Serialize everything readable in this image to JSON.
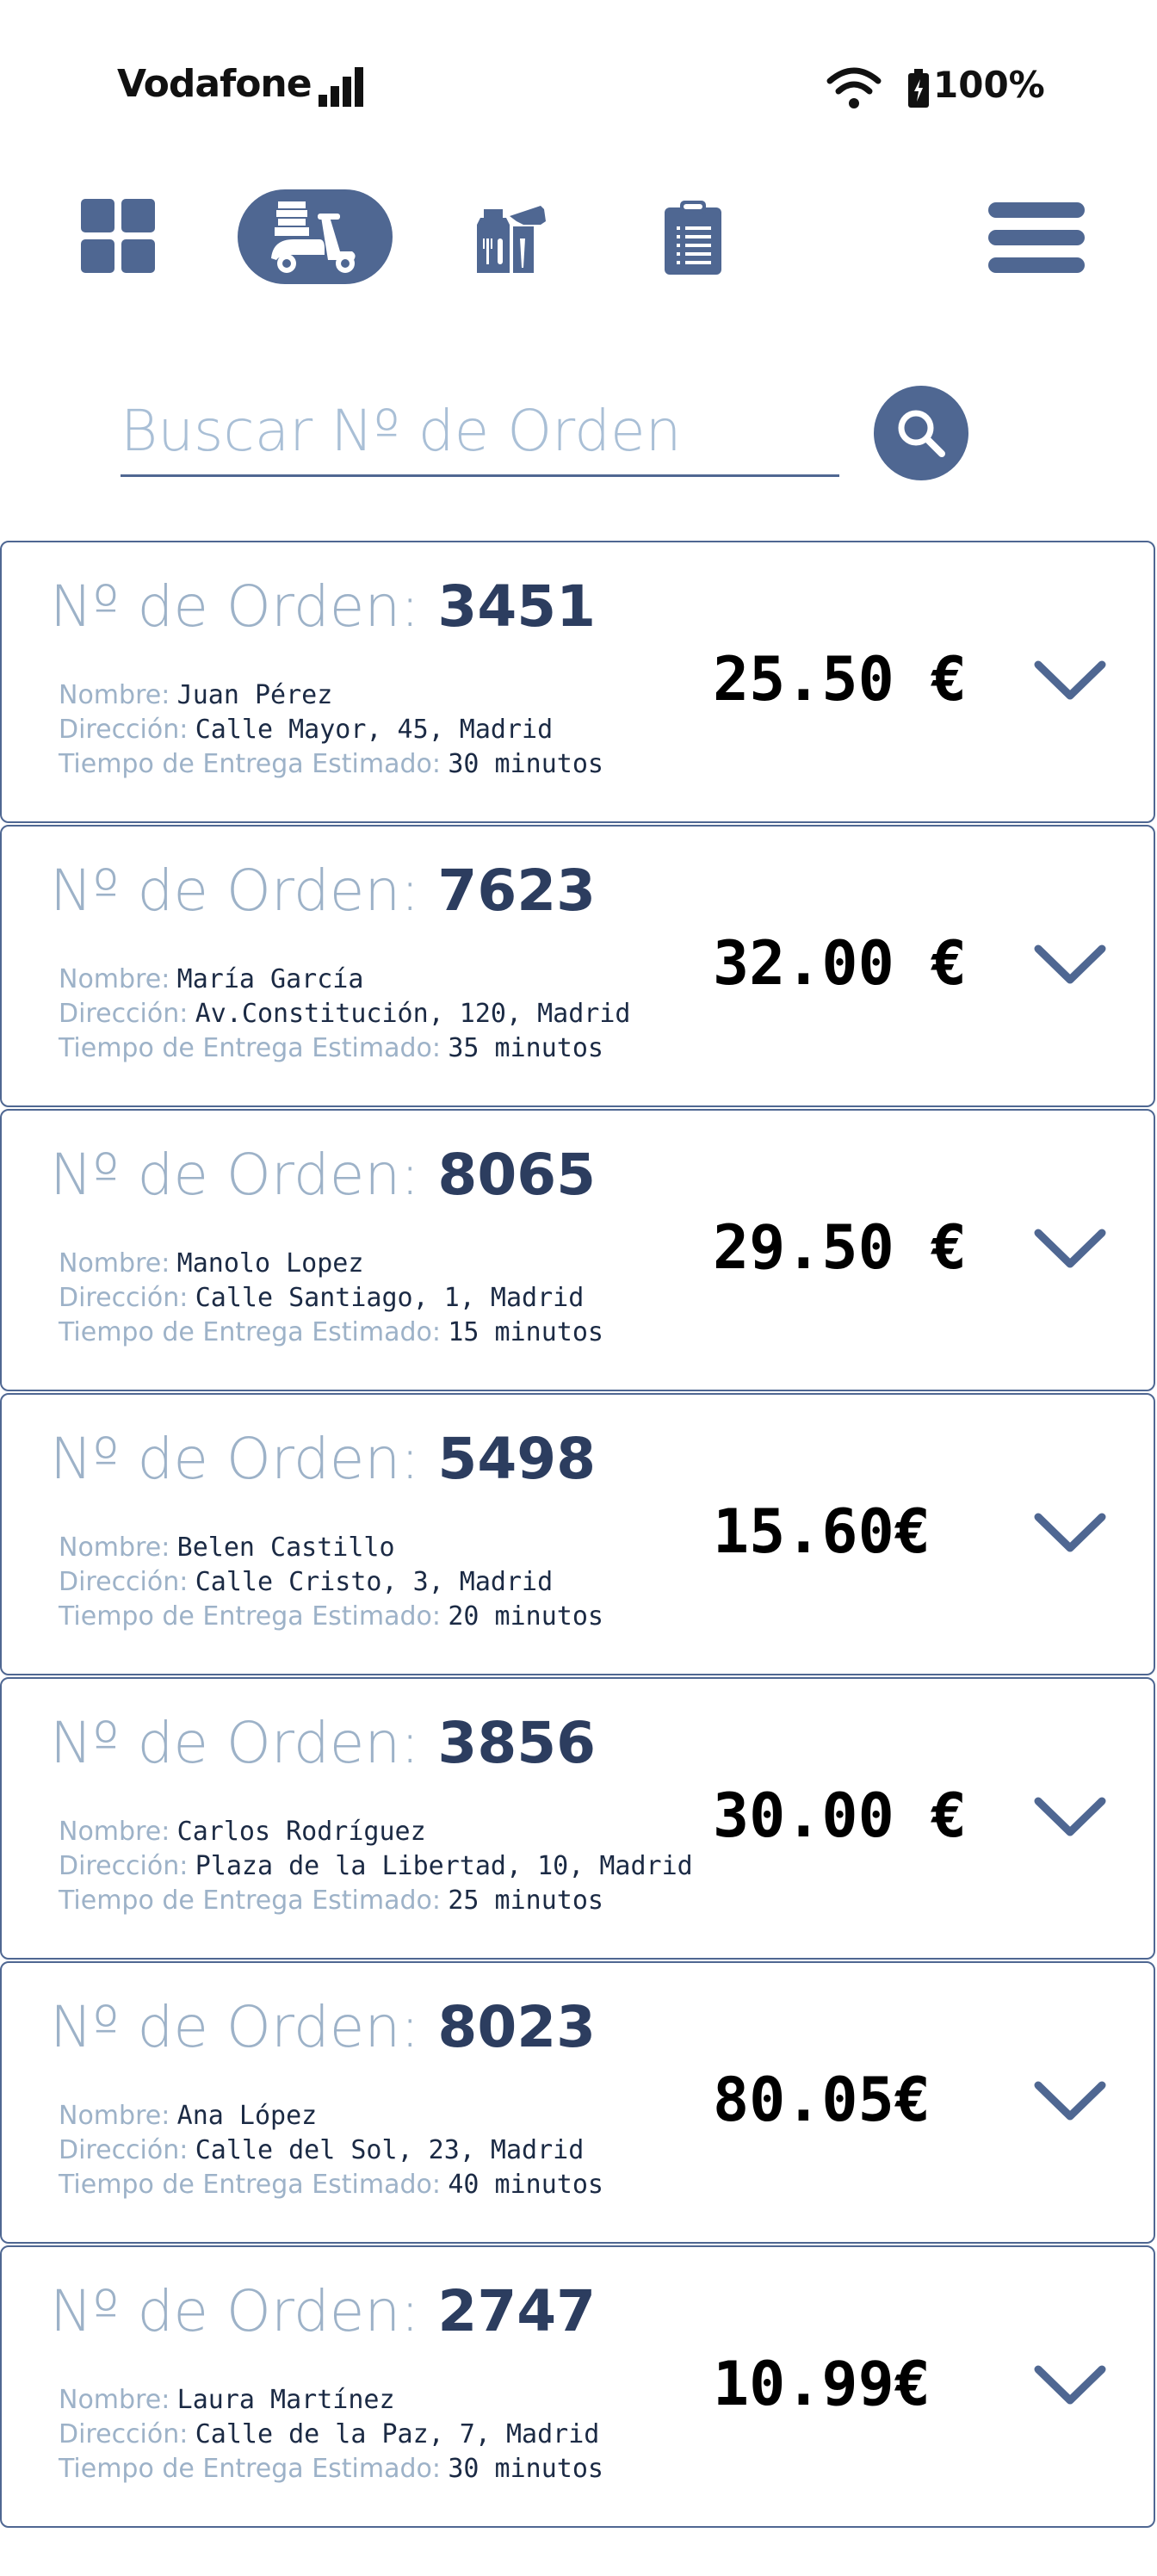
{
  "status_bar": {
    "carrier": "Vodafone",
    "battery": "100%"
  },
  "nav": {
    "items": [
      {
        "name": "dashboard",
        "icon": "grid-icon",
        "active": false
      },
      {
        "name": "delivery",
        "icon": "scooter-icon",
        "active": true
      },
      {
        "name": "restaurant",
        "icon": "food-bag-icon",
        "active": false
      },
      {
        "name": "orders",
        "icon": "clipboard-icon",
        "active": false
      },
      {
        "name": "menu",
        "icon": "hamburger-icon",
        "active": false
      }
    ]
  },
  "search": {
    "placeholder": "Buscar Nº de Orden",
    "value": ""
  },
  "labels": {
    "order_prefix": "Nº de Orden: ",
    "name": "Nombre:",
    "address": "Dirección:",
    "eta": "Tiempo de Entrega Estimado:"
  },
  "orders": [
    {
      "number": "3451",
      "name": "Juan Pérez",
      "address": "Calle Mayor, 45, Madrid",
      "eta": "30 minutos",
      "price": "25.50 €"
    },
    {
      "number": "7623",
      "name": "María García",
      "address": "Av.Constitución, 120, Madrid",
      "eta": "35 minutos",
      "price": "32.00 €"
    },
    {
      "number": "8065",
      "name": "Manolo Lopez",
      "address": "Calle Santiago, 1, Madrid",
      "eta": "15 minutos",
      "price": "29.50 €"
    },
    {
      "number": "5498",
      "name": "Belen Castillo",
      "address": "Calle Cristo, 3, Madrid",
      "eta": "20 minutos",
      "price": "15.60€"
    },
    {
      "number": "3856",
      "name": "Carlos Rodríguez",
      "address": "Plaza de la Libertad, 10, Madrid",
      "eta": "25 minutos",
      "price": "30.00 €"
    },
    {
      "number": "8023",
      "name": "Ana López",
      "address": "Calle del Sol, 23, Madrid",
      "eta": "40 minutos",
      "price": "80.05€"
    },
    {
      "number": "2747",
      "name": "Laura Martínez",
      "address": "Calle de la Paz, 7, Madrid",
      "eta": "30 minutos",
      "price": "10.99€"
    }
  ],
  "colors": {
    "accent": "#4f6792",
    "label": "#9db2c8",
    "dark": "#2c3d5f"
  }
}
